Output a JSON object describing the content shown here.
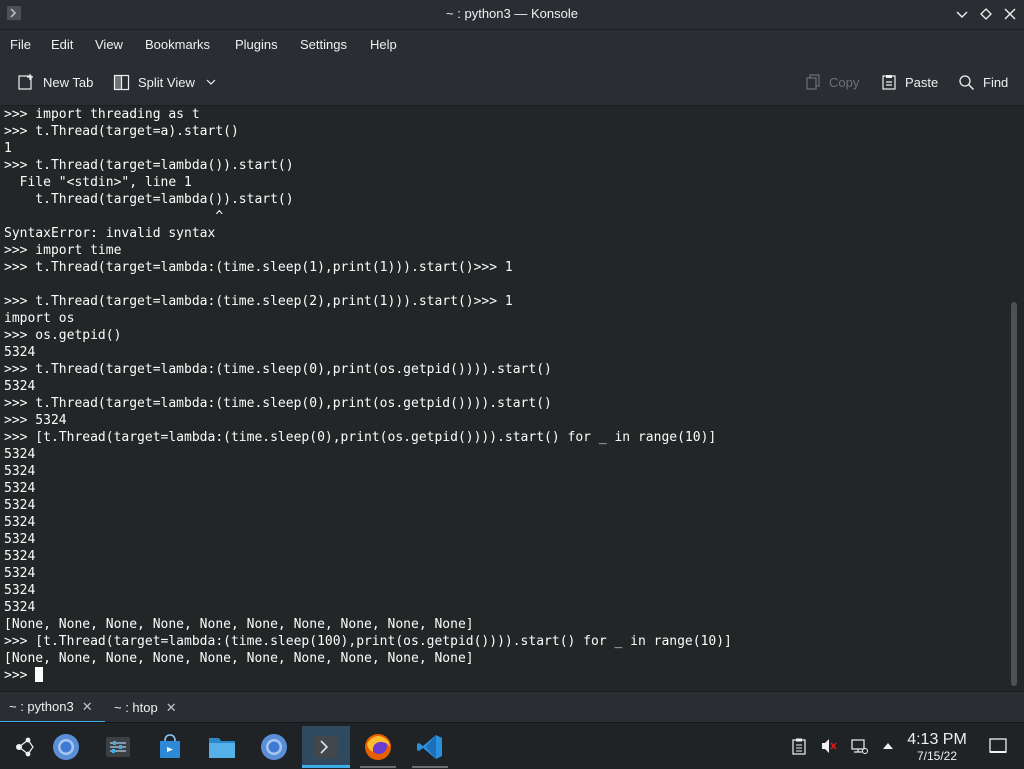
{
  "window": {
    "title": "~ : python3 — Konsole"
  },
  "menu": [
    "File",
    "Edit",
    "View",
    "Bookmarks",
    "Plugins",
    "Settings",
    "Help"
  ],
  "toolbar": {
    "new_tab": "New Tab",
    "split_view": "Split View",
    "copy": "Copy",
    "paste": "Paste",
    "find": "Find"
  },
  "terminal": {
    "lines": [
      ">>> import threading as t",
      ">>> t.Thread(target=a).start()",
      "1",
      ">>> t.Thread(target=lambda()).start()",
      "  File \"<stdin>\", line 1",
      "    t.Thread(target=lambda()).start()",
      "                           ^",
      "SyntaxError: invalid syntax",
      ">>> import time",
      ">>> t.Thread(target=lambda:(time.sleep(1),print(1))).start()>>> 1",
      "",
      ">>> t.Thread(target=lambda:(time.sleep(2),print(1))).start()>>> 1",
      "import os",
      ">>> os.getpid()",
      "5324",
      ">>> t.Thread(target=lambda:(time.sleep(0),print(os.getpid()))).start()",
      "5324",
      ">>> t.Thread(target=lambda:(time.sleep(0),print(os.getpid()))).start()",
      ">>> 5324",
      ">>> [t.Thread(target=lambda:(time.sleep(0),print(os.getpid()))).start() for _ in range(10)]",
      "5324",
      "5324",
      "5324",
      "5324",
      "5324",
      "5324",
      "5324",
      "5324",
      "5324",
      "5324",
      "[None, None, None, None, None, None, None, None, None, None]",
      ">>> [t.Thread(target=lambda:(time.sleep(100),print(os.getpid()))).start() for _ in range(10)]",
      "[None, None, None, None, None, None, None, None, None, None]"
    ],
    "prompt": ">>> "
  },
  "tabs": [
    {
      "label": "~ : python3",
      "active": true
    },
    {
      "label": "~ : htop",
      "active": false
    }
  ],
  "taskbar": {
    "apps": [
      "launcher-icon",
      "chromium-icon",
      "settings-icon",
      "store-icon",
      "files-icon",
      "chromium-icon",
      "konsole-icon",
      "firefox-icon",
      "vscode-icon"
    ]
  },
  "clock": {
    "time": "4:13 PM",
    "date": "7/15/22"
  },
  "colors": {
    "accent": "#3daee9",
    "background": "#232627",
    "chrome": "#2a2e32"
  }
}
